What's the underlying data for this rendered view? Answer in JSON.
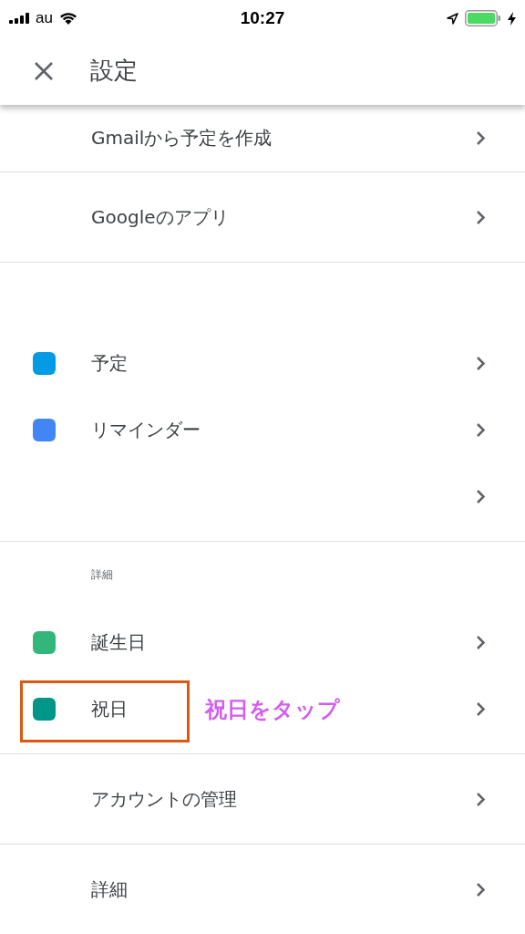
{
  "status_bar": {
    "carrier": "au",
    "time": "10:27"
  },
  "header": {
    "title": "設定"
  },
  "sections": [
    {
      "rows": [
        {
          "label": "Gmailから予定を作成"
        }
      ]
    },
    {
      "rows": [
        {
          "label": "Googleのアプリ"
        }
      ]
    },
    {
      "rows": [
        {
          "label": "予定",
          "color": "#039be5"
        },
        {
          "label": "リマインダー",
          "color": "#4285f4"
        },
        {}
      ]
    },
    {
      "heading": "詳細",
      "rows": [
        {
          "label": "誕生日",
          "color": "#33b679"
        },
        {
          "label": "祝日",
          "color": "#009688",
          "highlighted": true,
          "annotation": "祝日をタップ"
        }
      ]
    },
    {
      "rows": [
        {
          "label": "アカウントの管理"
        }
      ]
    },
    {
      "rows": [
        {
          "label": "詳細"
        }
      ]
    }
  ]
}
